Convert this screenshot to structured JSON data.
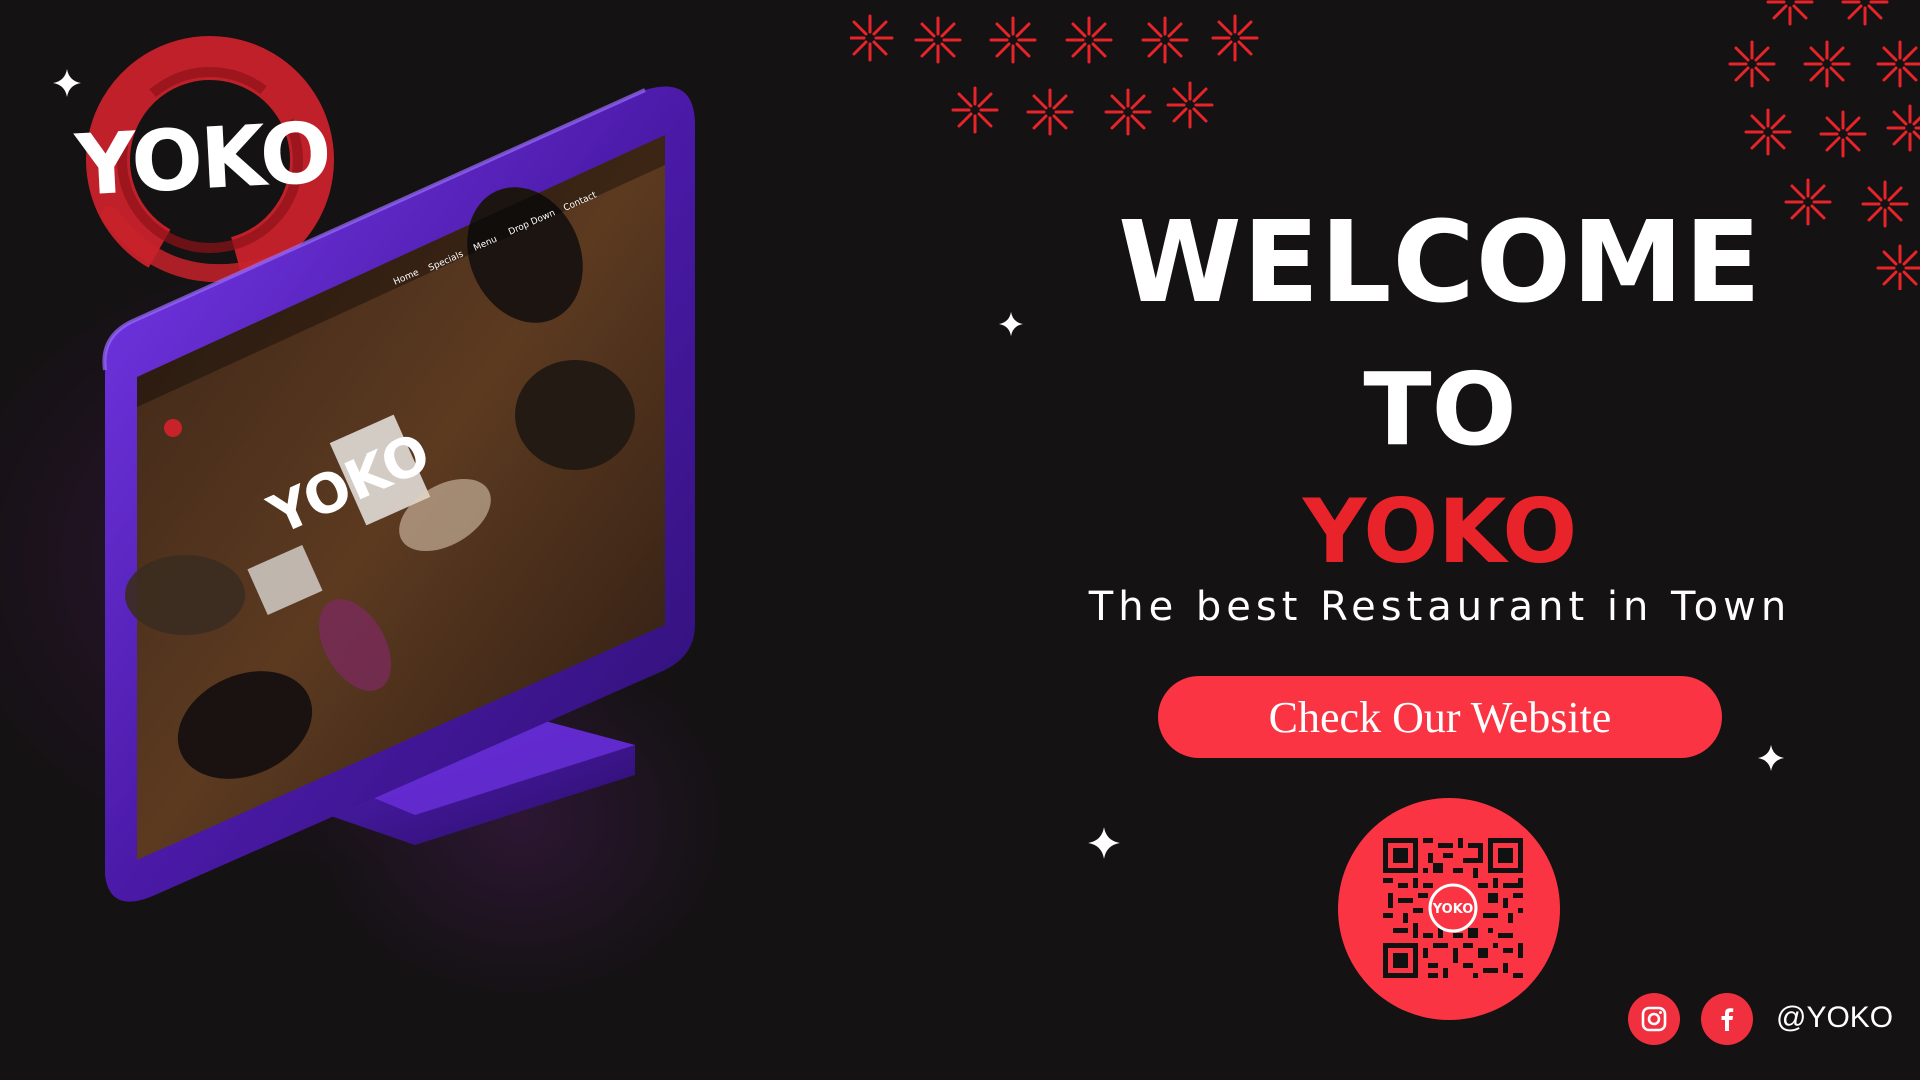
{
  "logo": {
    "text": "YOKO",
    "ring_color": "#c8222a"
  },
  "screen": {
    "nav_items": [
      "Home",
      "Specials",
      "Menu",
      "Drop Down",
      "Contact"
    ],
    "screen_logo_text": "YOKO",
    "frame_color": "#5b20c4"
  },
  "hero": {
    "line1": "WELCOME",
    "line2": "TO",
    "brand": "YOKO",
    "tagline": "The best Restaurant in Town"
  },
  "cta": {
    "label": "Check Our Website"
  },
  "qr": {
    "center_text": "YOKO"
  },
  "social": {
    "icons": [
      "instagram-icon",
      "facebook-icon"
    ],
    "handle": "@YOKO"
  },
  "colors": {
    "background": "#141213",
    "accent_red": "#fa3443",
    "brand_red": "#e8242a",
    "monitor_purple": "#5b20c4"
  }
}
